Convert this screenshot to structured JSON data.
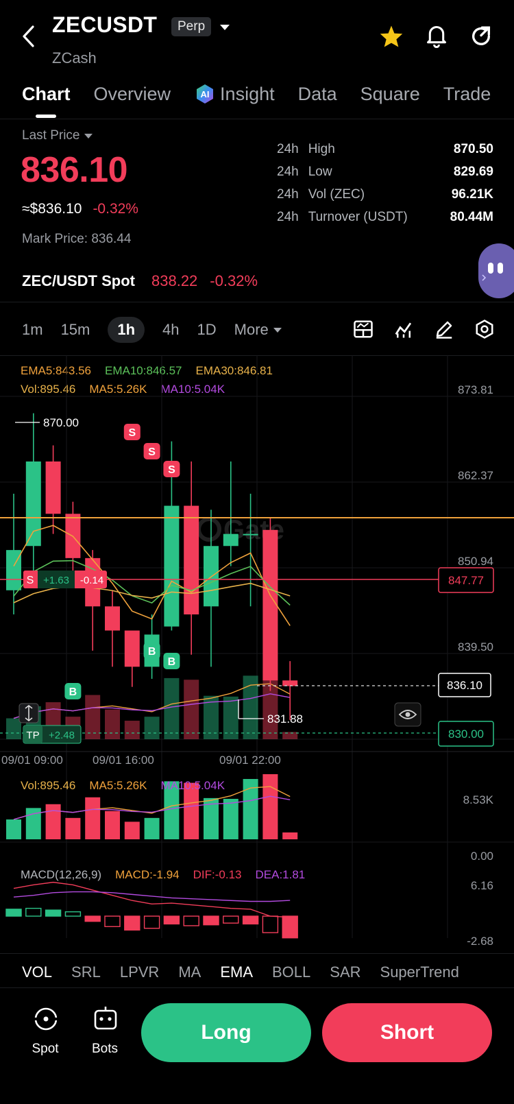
{
  "header": {
    "symbol": "ZECUSDT",
    "badge": "Perp",
    "name": "ZCash"
  },
  "tabs": [
    {
      "label": "Chart",
      "active": true
    },
    {
      "label": "Overview"
    },
    {
      "label": "Insight"
    },
    {
      "label": "Data"
    },
    {
      "label": "Square"
    },
    {
      "label": "Trade"
    }
  ],
  "price": {
    "last_label": "Last Price",
    "last": "836.10",
    "usd": "≈$836.10",
    "change": "-0.32%",
    "mark": "Mark Price: 836.44"
  },
  "stats": [
    {
      "period": "24h",
      "label": "High",
      "value": "870.50"
    },
    {
      "period": "24h",
      "label": "Low",
      "value": "829.69"
    },
    {
      "period": "24h",
      "label": "Vol (ZEC)",
      "value": "96.21K"
    },
    {
      "period": "24h",
      "label": "Turnover (USDT)",
      "value": "80.44M"
    }
  ],
  "spot": {
    "label": "ZEC/USDT Spot",
    "price": "838.22",
    "change": "-0.32%"
  },
  "intervals": [
    "1m",
    "15m",
    "1h",
    "4h",
    "1D"
  ],
  "more_label": "More",
  "legend": {
    "ema5": "EMA5:843.56",
    "ema10": "EMA10:846.57",
    "ema30": "EMA30:846.81",
    "vol": "Vol:895.46",
    "ma5": "MA5:5.26K",
    "ma10": "MA10:5.04K",
    "macd_name": "MACD(12,26,9)",
    "macd": "MACD:-1.94",
    "dif": "DIF:-0.13",
    "dea": "DEA:1.81"
  },
  "chart": {
    "y_labels": [
      "873.81",
      "862.37",
      "850.94",
      "839.50"
    ],
    "x_labels": [
      "09/01 09:00",
      "09/01 16:00",
      "09/01 22:00"
    ],
    "high_label": "870.00",
    "low_label": "831.88",
    "position_price": "847.77",
    "last_price": "836.10",
    "tp_price": "830.00",
    "position_side": "S",
    "position_pnl": "+1.63",
    "position_diff": "-0.14",
    "tp_label": "TP",
    "tp_pnl": "+2.48",
    "sell_marker": "S",
    "buy_marker": "B",
    "watermark": "Gate",
    "vol_max": "8.53K",
    "vol_min": "0.00",
    "macd_max": "6.16",
    "macd_min": "-2.68"
  },
  "chart_data": {
    "type": "candlestick",
    "x_labels": [
      "09/01 09:00",
      "09/01 16:00",
      "09/01 22:00"
    ],
    "ylim": [
      829.5,
      875.5
    ],
    "candles": [
      {
        "o": 848.0,
        "c": 853.0,
        "h": 860.0,
        "l": 845.0
      },
      {
        "o": 853.5,
        "c": 864.0,
        "h": 870.0,
        "l": 850.0
      },
      {
        "o": 864.0,
        "c": 857.5,
        "h": 866.0,
        "l": 855.0
      },
      {
        "o": 857.5,
        "c": 852.0,
        "h": 859.0,
        "l": 849.0
      },
      {
        "o": 852.0,
        "c": 846.0,
        "h": 853.0,
        "l": 840.5
      },
      {
        "o": 846.0,
        "c": 843.0,
        "h": 848.0,
        "l": 838.5
      },
      {
        "o": 843.0,
        "c": 838.5,
        "h": 843.0,
        "l": 836.0
      },
      {
        "o": 838.5,
        "c": 842.5,
        "h": 845.0,
        "l": 837.0
      },
      {
        "o": 843.5,
        "c": 858.5,
        "h": 866.5,
        "l": 843.0
      },
      {
        "o": 858.5,
        "c": 845.0,
        "h": 864.0,
        "l": 840.0
      },
      {
        "o": 846.0,
        "c": 853.5,
        "h": 858.0,
        "l": 838.5
      },
      {
        "o": 853.5,
        "c": 855.0,
        "h": 864.0,
        "l": 851.0
      },
      {
        "o": 855.0,
        "c": 855.0,
        "h": 860.0,
        "l": 846.0
      },
      {
        "o": 855.5,
        "c": 836.8,
        "h": 857.0,
        "l": 835.5
      },
      {
        "o": 836.8,
        "c": 836.1,
        "h": 839.2,
        "l": 831.88
      }
    ],
    "volume": [
      2.6,
      4.1,
      4.6,
      2.8,
      5.5,
      3.7,
      2.3,
      2.8,
      7.6,
      7.4,
      5.4,
      5.3,
      7.9,
      8.53,
      0.9
    ],
    "macd_hist": [
      0.8,
      0.9,
      0.7,
      0.5,
      -0.6,
      -1.2,
      -1.6,
      -1.4,
      -0.9,
      -1.1,
      -1.0,
      -0.8,
      -0.9,
      -1.9,
      -2.5
    ],
    "dif": [
      3.2,
      3.6,
      3.9,
      3.6,
      3.0,
      2.4,
      1.8,
      1.4,
      1.5,
      1.3,
      1.1,
      0.9,
      0.8,
      0.0,
      -0.13
    ],
    "dea": [
      2.2,
      2.4,
      2.7,
      2.8,
      2.8,
      2.7,
      2.5,
      2.3,
      2.1,
      2.0,
      1.9,
      1.8,
      1.7,
      1.7,
      1.81
    ]
  },
  "indicator_tabs": [
    {
      "label": "VOL",
      "active": true
    },
    {
      "label": "SRL"
    },
    {
      "label": "LPVR"
    },
    {
      "label": "MA"
    },
    {
      "label": "EMA",
      "active": true
    },
    {
      "label": "BOLL"
    },
    {
      "label": "SAR"
    },
    {
      "label": "SuperTrend"
    }
  ],
  "bottom": {
    "spot": "Spot",
    "bots": "Bots",
    "long": "Long",
    "short": "Short"
  },
  "colors": {
    "up": "#2bc287",
    "down": "#f23d5a",
    "ema5": "#f0a23c",
    "ema10": "#5cc25a",
    "ema30": "#e8b24a",
    "ma10": "#b34be0"
  }
}
